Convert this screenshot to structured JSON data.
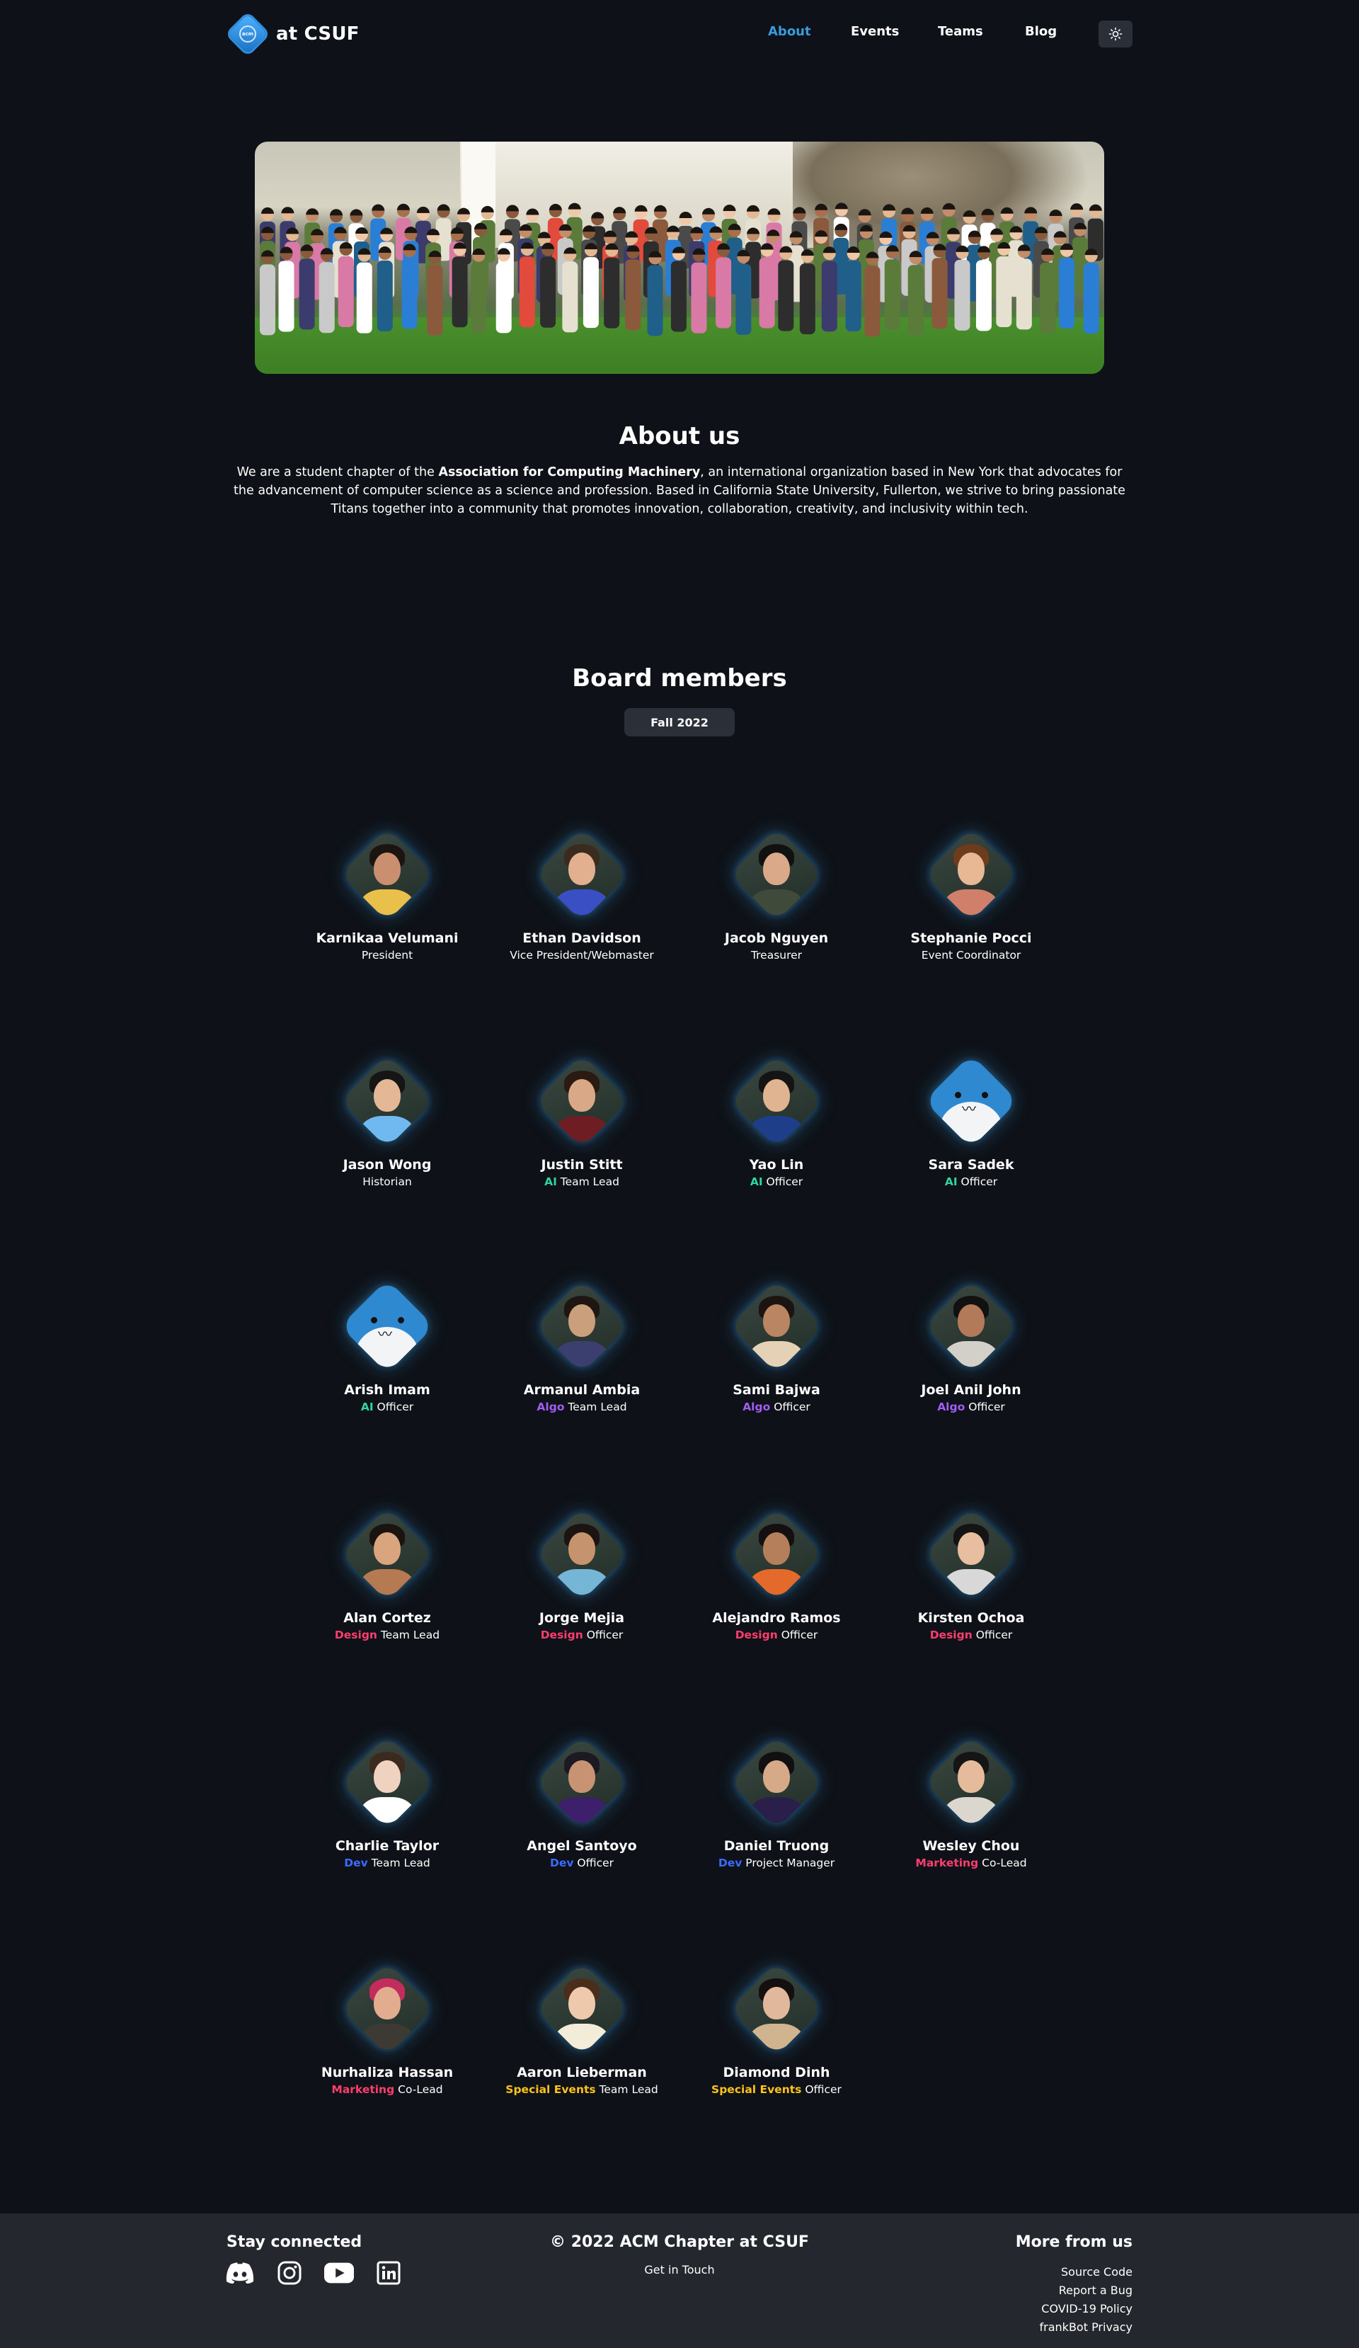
{
  "nav": {
    "brand_text": "at CSUF",
    "logo_text": "acm",
    "links": [
      {
        "label": "About",
        "active": true
      },
      {
        "label": "Events",
        "active": false
      },
      {
        "label": "Teams",
        "active": false
      },
      {
        "label": "Blog",
        "active": false
      }
    ],
    "theme_icon": "sun-icon",
    "accent_color": "#3a9bdc"
  },
  "hero": {
    "image": "group-photo"
  },
  "about": {
    "title": "About us",
    "text_before": "We are a student chapter of the ",
    "text_bold": "Association for Computing Machinery",
    "text_after": ", an international organization based in New York that advocates for the advancement of computer science as a science and profession. Based in California State University, Fullerton, we strive to bring passionate Titans together into a community that promotes innovation, collaboration, creativity, and inclusivity within tech."
  },
  "board": {
    "title": "Board members",
    "term": "Fall 2022",
    "team_colors": {
      "AI": "#2fd6a0",
      "Algo": "#a35cf5",
      "Design": "#ff3d6e",
      "Dev": "#3a6bff",
      "Marketing": "#ff3d6e",
      "Special Events": "#ffc21a"
    },
    "members": [
      {
        "name": "Karnikaa Velumani",
        "team": "",
        "role": "President"
      },
      {
        "name": "Ethan Davidson",
        "team": "",
        "role": "Vice President/Webmaster"
      },
      {
        "name": "Jacob Nguyen",
        "team": "",
        "role": "Treasurer"
      },
      {
        "name": "Stephanie Pocci",
        "team": "",
        "role": "Event Coordinator"
      },
      {
        "name": "Jason Wong",
        "team": "",
        "role": "Historian"
      },
      {
        "name": "Justin Stitt",
        "team": "AI",
        "role": "Team Lead"
      },
      {
        "name": "Yao Lin",
        "team": "AI",
        "role": "Officer"
      },
      {
        "name": "Sara Sadek",
        "team": "AI",
        "role": "Officer"
      },
      {
        "name": "Arish Imam",
        "team": "AI",
        "role": "Officer"
      },
      {
        "name": "Armanul Ambia",
        "team": "Algo",
        "role": "Team Lead"
      },
      {
        "name": "Sami Bajwa",
        "team": "Algo",
        "role": "Officer"
      },
      {
        "name": "Joel Anil John",
        "team": "Algo",
        "role": "Officer"
      },
      {
        "name": "Alan Cortez",
        "team": "Design",
        "role": "Team Lead"
      },
      {
        "name": "Jorge Mejia",
        "team": "Design",
        "role": "Officer"
      },
      {
        "name": "Alejandro Ramos",
        "team": "Design",
        "role": "Officer"
      },
      {
        "name": "Kirsten Ochoa",
        "team": "Design",
        "role": "Officer"
      },
      {
        "name": "Charlie Taylor",
        "team": "Dev",
        "role": "Team Lead"
      },
      {
        "name": "Angel Santoyo",
        "team": "Dev",
        "role": "Officer"
      },
      {
        "name": "Daniel Truong",
        "team": "Dev",
        "role": "Project Manager"
      },
      {
        "name": "Wesley Chou",
        "team": "Marketing",
        "role": "Co-Lead"
      },
      {
        "name": "Nurhaliza Hassan",
        "team": "Marketing",
        "role": "Co-Lead"
      },
      {
        "name": "Aaron Lieberman",
        "team": "Special Events",
        "role": "Team Lead"
      },
      {
        "name": "Diamond Dinh",
        "team": "Special Events",
        "role": "Officer"
      }
    ]
  },
  "footer": {
    "left_title": "Stay connected",
    "socials": [
      "discord-icon",
      "instagram-icon",
      "youtube-icon",
      "linkedin-icon"
    ],
    "center_title": "© 2022 ACM Chapter at CSUF",
    "center_link": "Get in Touch",
    "right_title": "More from us",
    "right_links": [
      "Source Code",
      "Report a Bug",
      "COVID-19 Policy",
      "frankBot Privacy"
    ]
  }
}
